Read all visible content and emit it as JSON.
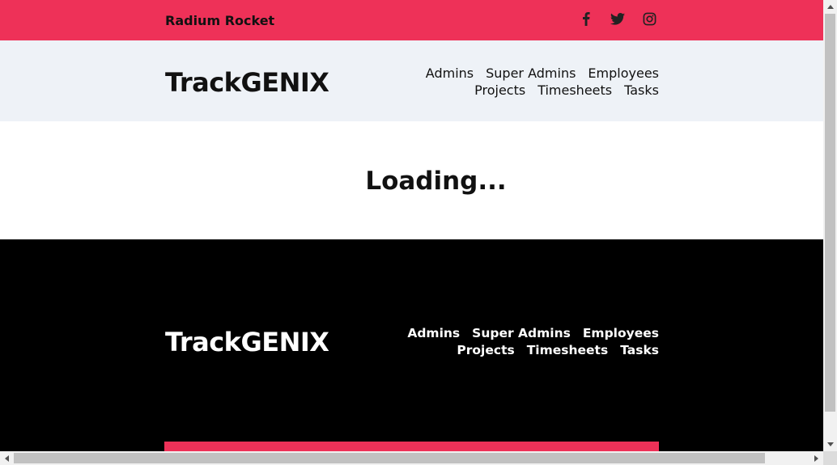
{
  "topbar": {
    "brand": "Radium Rocket",
    "accent_color": "#ee3158",
    "social": [
      {
        "icon": "facebook-icon"
      },
      {
        "icon": "twitter-icon"
      },
      {
        "icon": "instagram-icon"
      }
    ]
  },
  "header": {
    "logo": "TrackGENIX",
    "background": "#eef2f7",
    "nav": [
      "Admins",
      "Super Admins",
      "Employees",
      "Projects",
      "Timesheets",
      "Tasks"
    ]
  },
  "main": {
    "loading_text": "Loading..."
  },
  "footer": {
    "logo": "TrackGENIX",
    "background": "#000000",
    "nav": [
      "Admins",
      "Super Admins",
      "Employees",
      "Projects",
      "Timesheets",
      "Tasks"
    ]
  }
}
